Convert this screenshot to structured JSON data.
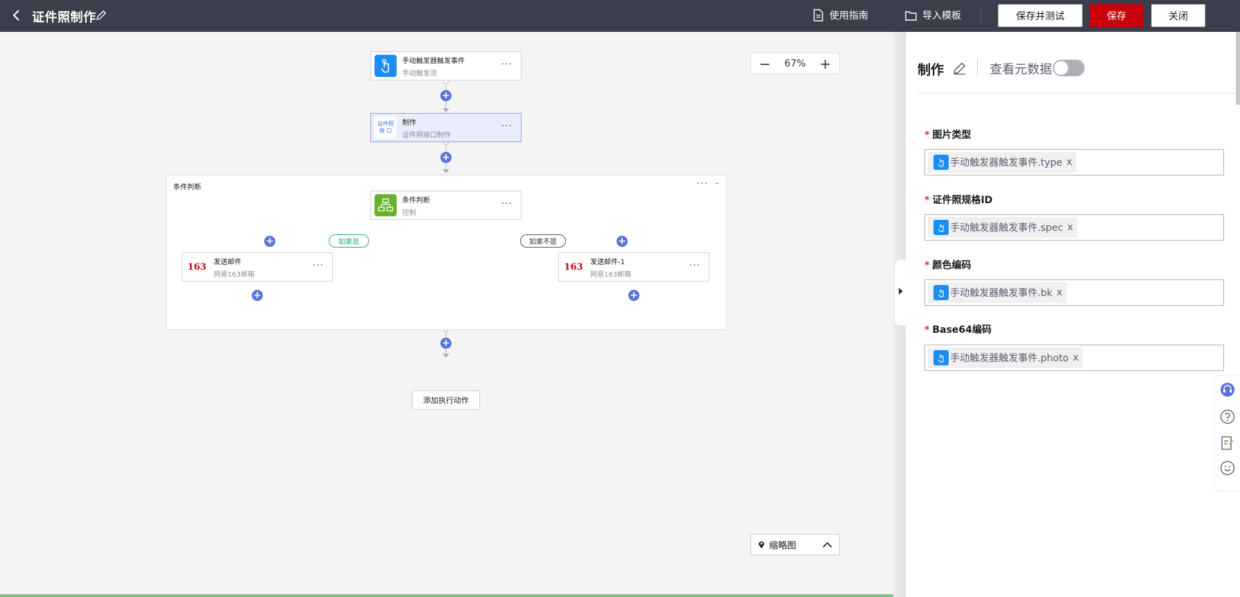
{
  "header": {
    "title": "证件照制作",
    "guide_label": "使用指南",
    "import_label": "导入模板",
    "save_test_label": "保存并测试",
    "save_label": "保存",
    "close_label": "关闭",
    "bg_color": "#3b3f4b",
    "accent_color": "#c7000b"
  },
  "canvas": {
    "zoom": "67%",
    "nodes": {
      "trigger": {
        "title": "手动触发器触发事件",
        "subtitle": "手动触发流"
      },
      "make": {
        "title": "制作",
        "subtitle": "证件照接口制作",
        "icon_text_1": "证件照",
        "icon_text_2": "接 口"
      },
      "condition_group": {
        "title": "条件判断"
      },
      "condition": {
        "title": "条件判断",
        "subtitle": "控制"
      },
      "mail_yes": {
        "title": "发送邮件",
        "subtitle": "网易163邮箱",
        "icon_text": "163"
      },
      "mail_no": {
        "title": "发送邮件-1",
        "subtitle": "网易163邮箱",
        "icon_text": "163"
      }
    },
    "branch_yes_label": "如果是",
    "branch_no_label": "如果不是",
    "add_action_label": "添加执行动作",
    "minimap_label": "缩略图",
    "more_glyph": "···",
    "plus_glyph": "+"
  },
  "panel": {
    "title": "制作",
    "metadata_label": "查看元数据",
    "metadata_enabled": false,
    "fields": [
      {
        "label": "图片类型",
        "required_mark": "*",
        "value": "手动触发器触发事件.type",
        "remove": "x"
      },
      {
        "label": "证件照规格ID",
        "required_mark": "*",
        "value": "手动触发器触发事件.spec",
        "remove": "x"
      },
      {
        "label": "颜色编码",
        "required_mark": "*",
        "value": "手动触发器触发事件.bk",
        "remove": "x"
      },
      {
        "label": "Base64编码",
        "required_mark": "*",
        "value": "手动触发器触发事件.photo",
        "remove": "x"
      }
    ]
  },
  "side_tools": [
    "headset-icon",
    "help-icon",
    "feedback-icon",
    "smiley-icon"
  ]
}
